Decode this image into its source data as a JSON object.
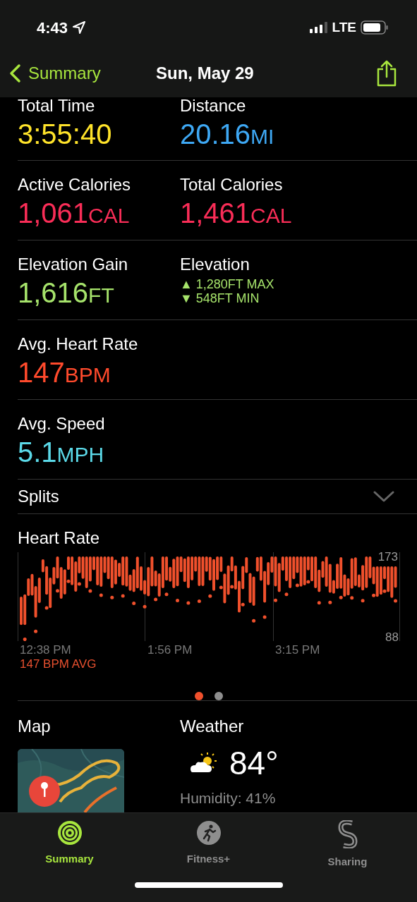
{
  "status_bar": {
    "time": "4:43",
    "network": "LTE"
  },
  "nav": {
    "back": "Summary",
    "title": "Sun, May 29"
  },
  "metric_rows": [
    {
      "cells": [
        {
          "kind": "value",
          "label": "Total Time",
          "value": "3:55:40",
          "color": "#ffe32a"
        },
        {
          "kind": "value",
          "label": "Distance",
          "value": "20.16",
          "unit": "MI",
          "color": "#3ea8f4"
        }
      ]
    },
    {
      "cells": [
        {
          "kind": "value",
          "label": "Active Calories",
          "value": "1,061",
          "unit": "CAL",
          "color": "#f92d57"
        },
        {
          "kind": "value",
          "label": "Total Calories",
          "value": "1,461",
          "unit": "CAL",
          "color": "#f92d57"
        }
      ]
    },
    {
      "cells": [
        {
          "kind": "value",
          "label": "Elevation Gain",
          "value": "1,616",
          "unit": "FT",
          "color": "#a6e36b"
        },
        {
          "kind": "range",
          "label": "Elevation",
          "max": "▲ 1,280FT MAX",
          "min": "▼ 548FT MIN",
          "color": "#a6e36b"
        }
      ]
    },
    {
      "cells": [
        {
          "kind": "value",
          "label": "Avg. Heart Rate",
          "value": "147",
          "unit": "BPM",
          "color": "#ff4a2c"
        }
      ]
    },
    {
      "cells": [
        {
          "kind": "value",
          "label": "Avg. Speed",
          "value": "5.1",
          "unit": "MPH",
          "color": "#5bd9e8"
        }
      ]
    }
  ],
  "splits": {
    "label": "Splits",
    "expanded": false
  },
  "heart_rate": {
    "title": "Heart Rate",
    "y_max": "173",
    "y_min": "88",
    "x_labels": [
      "12:38 PM",
      "1:56 PM",
      "3:15 PM"
    ],
    "average": "147 BPM AVG"
  },
  "pages": [
    {
      "selected": true
    },
    {
      "selected": false
    }
  ],
  "map": {
    "title": "Map"
  },
  "weather": {
    "title": "Weather",
    "temperature": "84°",
    "humidity": "Humidity: 41%"
  },
  "tabs": [
    {
      "label": "Summary",
      "selected": true,
      "kind": "rings"
    },
    {
      "label": "Fitness+",
      "selected": false,
      "kind": "runner"
    },
    {
      "label": "Sharing",
      "selected": false,
      "kind": "sharing"
    }
  ]
}
